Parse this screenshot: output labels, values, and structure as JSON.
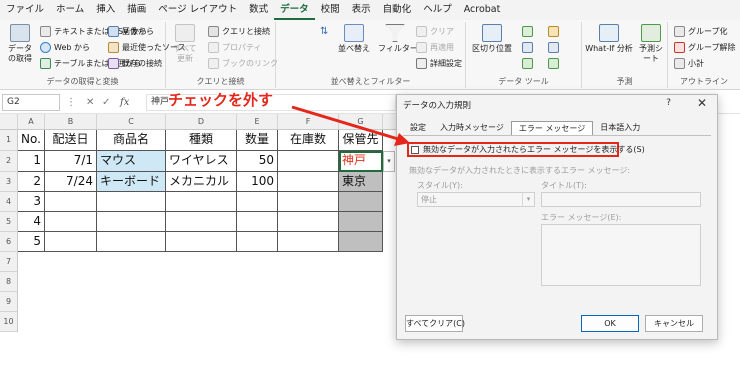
{
  "menu": {
    "items": [
      "ファイル",
      "ホーム",
      "挿入",
      "描画",
      "ページ レイアウト",
      "数式",
      "データ",
      "校閲",
      "表示",
      "自動化",
      "ヘルプ",
      "Acrobat"
    ],
    "active": "データ"
  },
  "ribbon": {
    "get_data": {
      "label": "データの取得と変換",
      "get_data_button": "データの取得",
      "from_text_csv": "テキストまたは CSV から",
      "from_web": "Web から",
      "from_table_range": "テーブルまたは範囲から",
      "image_from": "画像から",
      "recent_sources": "最近使ったソース",
      "existing_connections": "既存の接続"
    },
    "queries": {
      "label": "クエリと接続",
      "refresh_all": "すべて更新",
      "queries_connections": "クエリと接続",
      "properties": "プロパティ",
      "edit_links": "ブックのリンク"
    },
    "sort_filter": {
      "label": "並べ替えとフィルター",
      "sort": "並べ替え",
      "filter": "フィルター",
      "clear": "クリア",
      "reapply": "再適用",
      "advanced": "詳細設定"
    },
    "data_tools": {
      "label": "データ ツール",
      "text_to_columns": "区切り位置"
    },
    "forecast": {
      "label": "予測",
      "what_if": "What-If 分析",
      "forecast_sheet": "予測シート"
    },
    "outline": {
      "label": "アウトライン",
      "group": "グループ化",
      "ungroup": "グループ解除",
      "subtotal": "小計"
    }
  },
  "formula_bar": {
    "name_box": "G2",
    "fx": "fx",
    "content": "神戸"
  },
  "grid": {
    "columns": [
      "A",
      "B",
      "C",
      "D",
      "E",
      "F",
      "G"
    ],
    "rows": [
      "1",
      "2",
      "3",
      "4",
      "5",
      "6",
      "7",
      "8",
      "9",
      "10"
    ],
    "table_header": [
      "No.",
      "配送日",
      "商品名",
      "種類",
      "数量",
      "在庫数",
      "保管先"
    ],
    "data": [
      [
        "1",
        "7/1",
        "マウス",
        "ワイヤレス",
        "50",
        "",
        "神戸"
      ],
      [
        "2",
        "7/24",
        "キーボード",
        "メカニカル",
        "100",
        "",
        "東京"
      ],
      [
        "3",
        "",
        "",
        "",
        "",
        "",
        ""
      ],
      [
        "4",
        "",
        "",
        "",
        "",
        "",
        ""
      ],
      [
        "5",
        "",
        "",
        "",
        "",
        "",
        ""
      ]
    ]
  },
  "dialog": {
    "title": "データの入力規則",
    "help": "?",
    "close": "✕",
    "tabs": [
      "設定",
      "入力時メッセージ",
      "エラー メッセージ",
      "日本語入力"
    ],
    "active_tab": "エラー メッセージ",
    "checkbox_label": "無効なデータが入力されたらエラー メッセージを表示する(S)",
    "section_label": "無効なデータが入力されたときに表示するエラー メッセージ:",
    "style_label": "スタイル(Y):",
    "style_value": "停止",
    "title_label": "タイトル(T):",
    "error_message_label": "エラー メッセージ(E):",
    "clear_all": "すべてクリア(C)",
    "ok": "OK",
    "cancel": "キャンセル"
  },
  "annotation": {
    "text": "チェックを外す",
    "color": "#e4261b"
  },
  "colors": {
    "excel_green": "#1e6b3b",
    "highlight_blue": "#cfe8f6",
    "gray_fill": "#bfbfbf"
  }
}
